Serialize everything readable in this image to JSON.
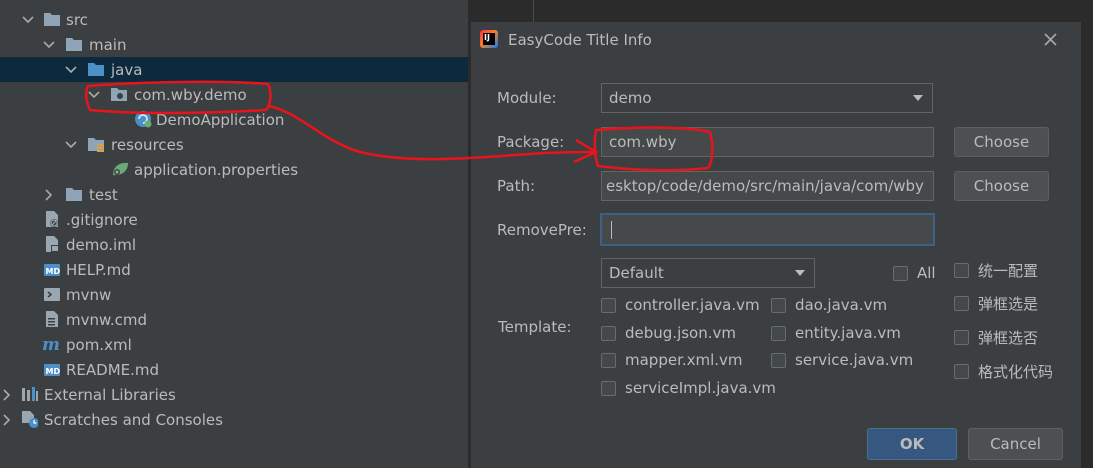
{
  "tree": {
    "items": [
      {
        "label": "src",
        "icon": "folder-icon"
      },
      {
        "label": "main",
        "icon": "folder-icon"
      },
      {
        "label": "java",
        "icon": "source-folder-icon"
      },
      {
        "label": "com.wby.demo",
        "icon": "package-icon"
      },
      {
        "label": "DemoApplication",
        "icon": "spring-boot-class-icon"
      },
      {
        "label": "resources",
        "icon": "resources-folder-icon"
      },
      {
        "label": "application.properties",
        "icon": "spring-properties-icon"
      },
      {
        "label": "test",
        "icon": "folder-icon"
      },
      {
        "label": ".gitignore",
        "icon": "ignore-file-icon"
      },
      {
        "label": "demo.iml",
        "icon": "module-file-icon"
      },
      {
        "label": "HELP.md",
        "icon": "markdown-icon"
      },
      {
        "label": "mvnw",
        "icon": "shell-script-icon"
      },
      {
        "label": "mvnw.cmd",
        "icon": "text-file-icon"
      },
      {
        "label": "pom.xml",
        "icon": "maven-icon"
      },
      {
        "label": "README.md",
        "icon": "markdown-icon"
      },
      {
        "label": "External Libraries",
        "icon": "libraries-icon"
      },
      {
        "label": "Scratches and Consoles",
        "icon": "scratches-icon"
      }
    ]
  },
  "dialog": {
    "title": "EasyCode Title Info",
    "module_label": "Module:",
    "module_value": "demo",
    "package_label": "Package:",
    "package_value": "com.wby",
    "path_label": "Path:",
    "path_value": "esktop/code/demo/src/main/java/com/wby",
    "remove_label": "RemovePre:",
    "remove_value": "",
    "choose_label": "Choose",
    "template_label": "Template:",
    "group_value": "Default",
    "all_label": "All",
    "templates": [
      "controller.java.vm",
      "dao.java.vm",
      "debug.json.vm",
      "entity.java.vm",
      "mapper.xml.vm",
      "service.java.vm",
      "serviceImpl.java.vm"
    ],
    "options": [
      "统一配置",
      "弹框选是",
      "弹框选否",
      "格式化代码"
    ],
    "ok_label": "OK",
    "cancel_label": "Cancel"
  },
  "colors": {
    "annotation": "#e8141b",
    "selection": "#0d293e",
    "ok_button": "#365880",
    "folder": "#90a4b8",
    "source_folder": "#4d8fc7"
  }
}
